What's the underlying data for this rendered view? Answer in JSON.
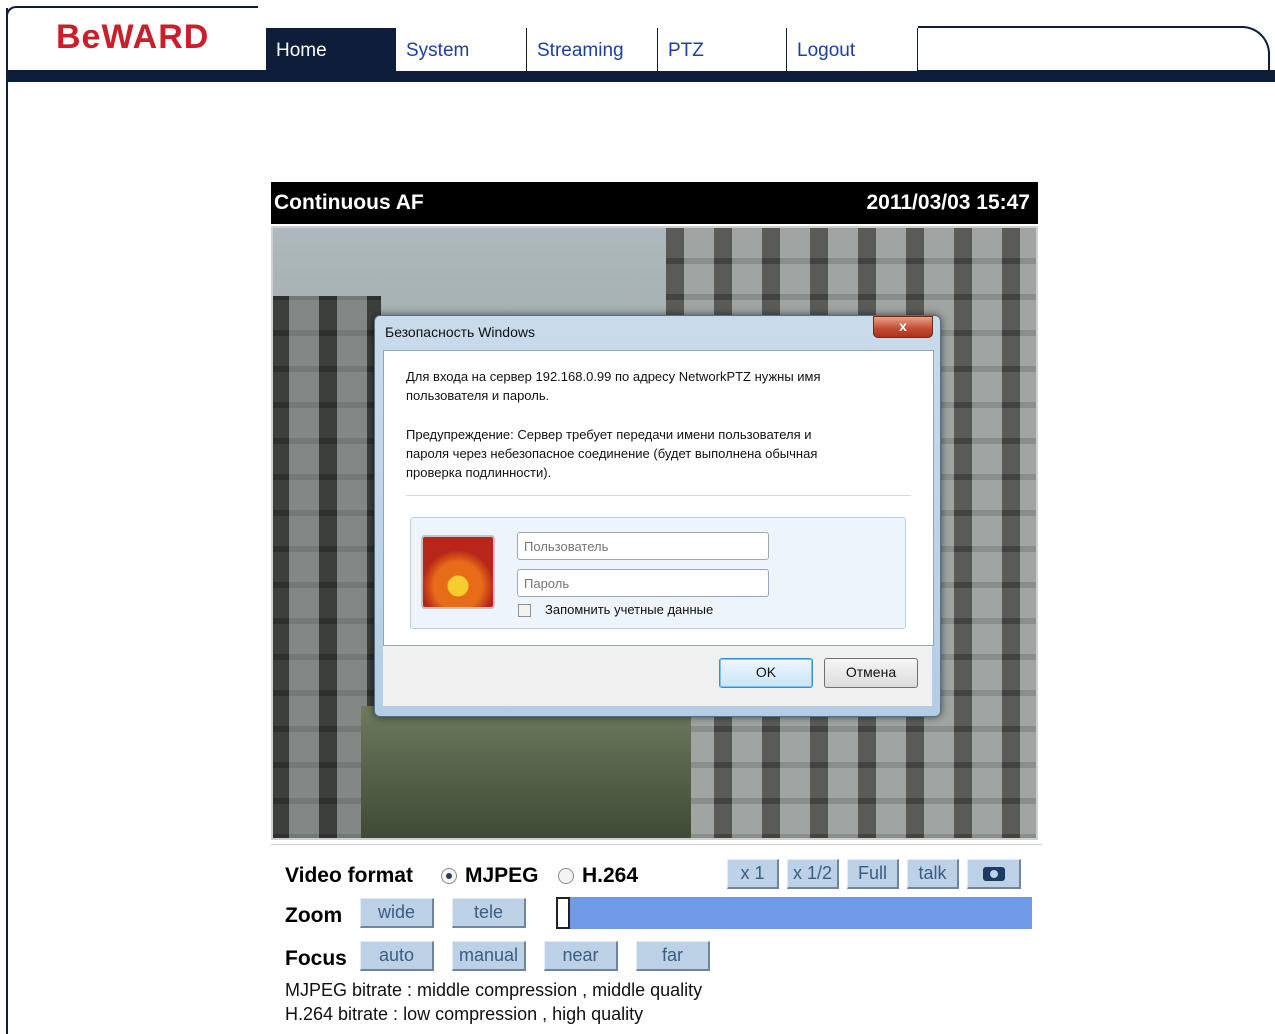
{
  "brand": {
    "logo_text": "BeWARD",
    "logo_color": "#c8202a",
    "navbar_color": "#0d1d3a"
  },
  "nav": {
    "tabs": [
      {
        "label": "Home",
        "active": true
      },
      {
        "label": "System",
        "active": false
      },
      {
        "label": "Streaming",
        "active": false
      },
      {
        "label": "PTZ",
        "active": false
      },
      {
        "label": "Logout",
        "active": false
      }
    ]
  },
  "viewer": {
    "title": "Continuous AF",
    "timestamp": "2011/03/03 15:47"
  },
  "dialog": {
    "title": "Безопасность Windows",
    "close_label": "x",
    "message_line1": "Для входа на сервер 192.168.0.99   по адресу NetworkPTZ нужны имя",
    "message_line2": "пользователя и пароль.",
    "warning_line1": "Предупреждение: Сервер требует передачи имени пользователя и",
    "warning_line2": "пароля через небезопасное соединение (будет выполнена обычная",
    "warning_line3": "проверка подлинности).",
    "username_placeholder": "Пользователь",
    "password_placeholder": "Пароль",
    "remember_label": "Запомнить учетные данные",
    "ok_label": "OK",
    "cancel_label": "Отмена"
  },
  "controls": {
    "video_format_label": "Video format",
    "format_options": [
      {
        "label": "MJPEG",
        "selected": true
      },
      {
        "label": "H.264",
        "selected": false
      }
    ],
    "size_buttons": [
      "x 1",
      "x 1/2",
      "Full",
      "talk"
    ],
    "snapshot_icon": "camera-icon",
    "zoom_label": "Zoom",
    "zoom_buttons": [
      "wide",
      "tele"
    ],
    "zoom_level": 0,
    "focus_label": "Focus",
    "focus_buttons": [
      "auto",
      "manual",
      "near",
      "far"
    ],
    "mjpeg_bitrate": "MJPEG bitrate : middle compression , middle quality",
    "h264_bitrate": "H.264 bitrate : low compression , high quality"
  }
}
